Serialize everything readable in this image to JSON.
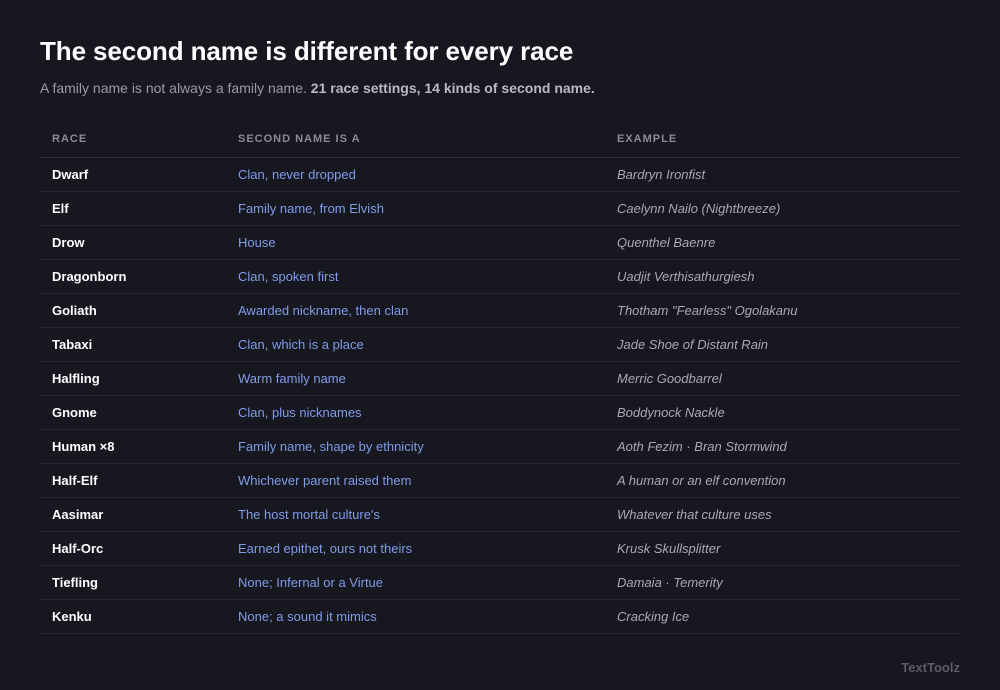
{
  "title": "The second name is different for every race",
  "subtitle": {
    "lead": "A family name is not always a family name.",
    "stat": "21 race settings, 14 kinds of second name."
  },
  "table": {
    "headers": [
      "RACE",
      "SECOND NAME IS A",
      "EXAMPLE"
    ],
    "rows": [
      {
        "race": "Dwarf",
        "kind": "Clan, never dropped",
        "example": "Bardryn Ironfist"
      },
      {
        "race": "Elf",
        "kind": "Family name, from Elvish",
        "example": "Caelynn Nailo (Nightbreeze)"
      },
      {
        "race": "Drow",
        "kind": "House",
        "example": "Quenthel Baenre"
      },
      {
        "race": "Dragonborn",
        "kind": "Clan, spoken first",
        "example": "Uadjit Verthisathurgiesh"
      },
      {
        "race": "Goliath",
        "kind": "Awarded nickname, then clan",
        "example": "Thotham \"Fearless\" Ogolakanu"
      },
      {
        "race": "Tabaxi",
        "kind": "Clan, which is a place",
        "example": "Jade Shoe of Distant Rain"
      },
      {
        "race": "Halfling",
        "kind": "Warm family name",
        "example": "Merric Goodbarrel"
      },
      {
        "race": "Gnome",
        "kind": "Clan, plus nicknames",
        "example": "Boddynock Nackle"
      },
      {
        "race": "Human ×8",
        "kind": "Family name, shape by ethnicity",
        "example": "Aoth Fezim · Bran Stormwind"
      },
      {
        "race": "Half-Elf",
        "kind": "Whichever parent raised them",
        "example": "A human or an elf convention"
      },
      {
        "race": "Aasimar",
        "kind": "The host mortal culture's",
        "example": "Whatever that culture uses"
      },
      {
        "race": "Half-Orc",
        "kind": "Earned epithet, ours not theirs",
        "example": "Krusk Skullsplitter"
      },
      {
        "race": "Tiefling",
        "kind": "None; Infernal or a Virtue",
        "example": "Damaia · Temerity"
      },
      {
        "race": "Kenku",
        "kind": "None; a sound it mimics",
        "example": "Cracking Ice"
      }
    ]
  },
  "footer": {
    "brand": "TextToolz"
  }
}
